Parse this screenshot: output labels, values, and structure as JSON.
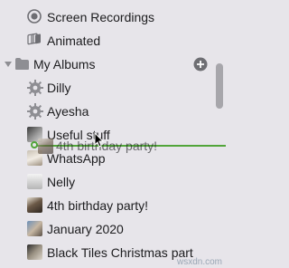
{
  "sidebar": {
    "items": [
      {
        "label": "Screen Recordings",
        "icon": "screen-recording-icon"
      },
      {
        "label": "Animated",
        "icon": "animated-icon"
      },
      {
        "label": "My Albums",
        "icon": "folder-icon"
      },
      {
        "label": "Dilly",
        "icon": "gear-icon"
      },
      {
        "label": "Ayesha",
        "icon": "gear-icon"
      },
      {
        "label": "Useful stuff",
        "icon": "album-thumbnail"
      },
      {
        "label": "WhatsApp",
        "icon": "album-thumbnail"
      },
      {
        "label": "Nelly",
        "icon": "album-thumbnail"
      },
      {
        "label": "4th birthday party!",
        "icon": "album-thumbnail"
      },
      {
        "label": "January 2020",
        "icon": "album-thumbnail"
      },
      {
        "label": "Black Tiles Christmas part",
        "icon": "album-thumbnail"
      }
    ],
    "drag_ghost_label": "4th birthday party!"
  },
  "watermark": "wsxdn.com",
  "colors": {
    "background": "#e7e5ea",
    "drop_indicator": "#52a53a",
    "icon": "#6e6e73"
  }
}
